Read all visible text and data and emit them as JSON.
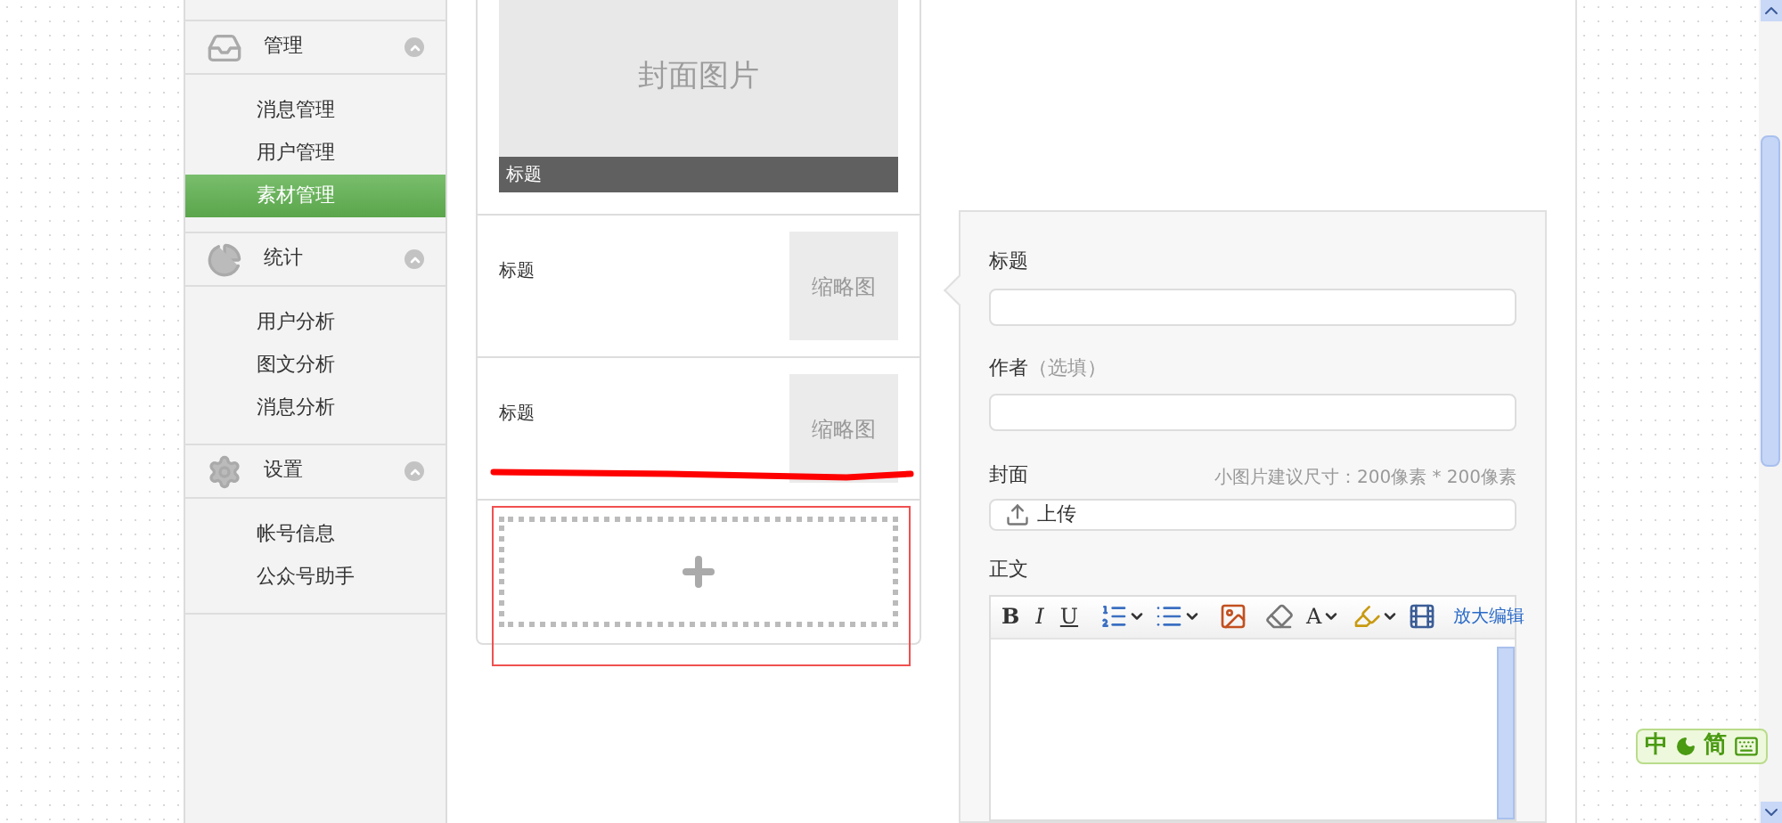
{
  "sidebar": {
    "groups": [
      {
        "title": "管理",
        "items": [
          {
            "label": "消息管理",
            "selected": false
          },
          {
            "label": "用户管理",
            "selected": false
          },
          {
            "label": "素材管理",
            "selected": true
          }
        ]
      },
      {
        "title": "统计",
        "items": [
          {
            "label": "用户分析",
            "selected": false
          },
          {
            "label": "图文分析",
            "selected": false
          },
          {
            "label": "消息分析",
            "selected": false
          }
        ]
      },
      {
        "title": "设置",
        "items": [
          {
            "label": "帐号信息",
            "selected": false
          },
          {
            "label": "公众号助手",
            "selected": false
          }
        ]
      }
    ]
  },
  "articles": {
    "cover": {
      "image_text": "封面图片",
      "title": "标题"
    },
    "items": [
      {
        "title": "标题",
        "thumb": "缩略图"
      },
      {
        "title": "标题",
        "thumb": "缩略图"
      }
    ]
  },
  "form": {
    "title": {
      "label": "标题"
    },
    "author": {
      "label": "作者",
      "hint": "（选填）"
    },
    "cover": {
      "label": "封面",
      "hint": "小图片建议尺寸：200像素 * 200像素",
      "upload": "上传"
    },
    "body": {
      "label": "正文",
      "expand": "放大编辑",
      "toolbar": [
        {
          "kind": "bold",
          "text": "B",
          "dropdown": false
        },
        {
          "kind": "italic",
          "text": "I",
          "dropdown": false
        },
        {
          "kind": "underline",
          "text": "U",
          "dropdown": false
        },
        {
          "kind": "sep"
        },
        {
          "kind": "numbered",
          "dropdown": true
        },
        {
          "kind": "bullets",
          "dropdown": true
        },
        {
          "kind": "sep"
        },
        {
          "kind": "image",
          "dropdown": false
        },
        {
          "kind": "sep"
        },
        {
          "kind": "eraser",
          "dropdown": false
        },
        {
          "kind": "fontcolor",
          "text": "A",
          "dropdown": true
        },
        {
          "kind": "highlight",
          "dropdown": true
        },
        {
          "kind": "video",
          "dropdown": false
        }
      ]
    }
  },
  "ime": {
    "mode": "中",
    "script": "简"
  }
}
